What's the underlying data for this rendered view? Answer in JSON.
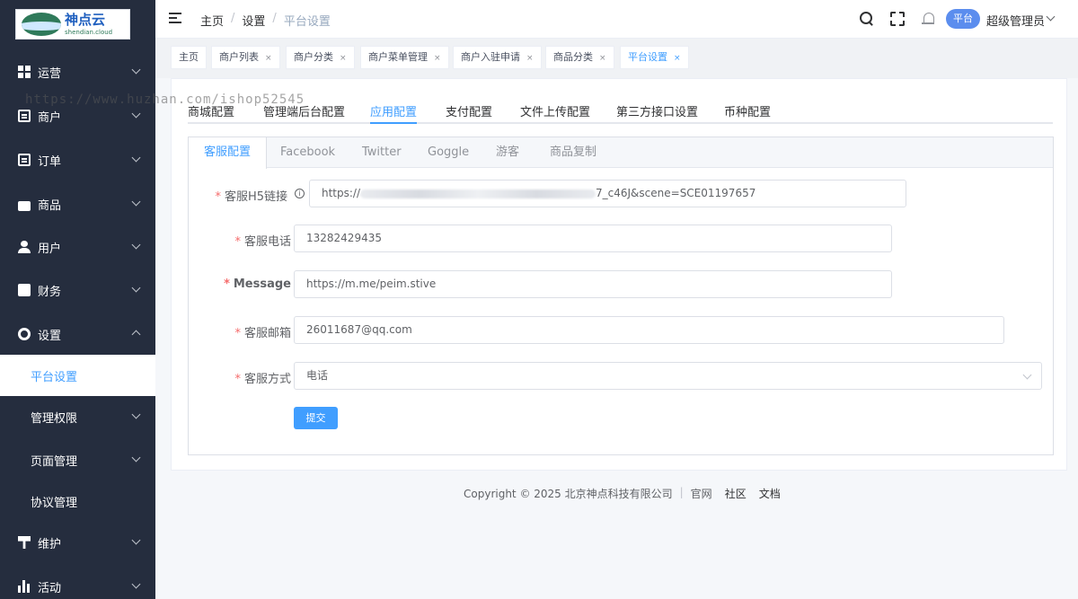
{
  "logo": {
    "name_cn": "神点云",
    "name_en": "shendian.cloud"
  },
  "watermark": "https://www.huzhan.com/ishop52545",
  "sidebar": {
    "items": [
      {
        "label": "运营",
        "icon": "grid-icon"
      },
      {
        "label": "商户",
        "icon": "shop-icon"
      },
      {
        "label": "订单",
        "icon": "order-icon"
      },
      {
        "label": "商品",
        "icon": "bag-icon"
      },
      {
        "label": "用户",
        "icon": "user-icon"
      },
      {
        "label": "财务",
        "icon": "wallet-icon"
      },
      {
        "label": "设置",
        "icon": "gear-icon"
      },
      {
        "label": "平台设置"
      },
      {
        "label": "管理权限"
      },
      {
        "label": "页面管理"
      },
      {
        "label": "协议管理"
      },
      {
        "label": "维护",
        "icon": "tool-icon"
      },
      {
        "label": "活动",
        "icon": "bars-icon"
      }
    ]
  },
  "header": {
    "breadcrumb": [
      "主页",
      "设置",
      "平台设置"
    ],
    "separator": "/",
    "role_badge": "平台",
    "user_name": "超级管理员"
  },
  "tags": [
    "主页",
    "商户列表",
    "商户分类",
    "商户菜单管理",
    "商户入驻申请",
    "商品分类",
    "平台设置"
  ],
  "tag_close": "×",
  "top_tabs": [
    "商城配置",
    "管理端后台配置",
    "应用配置",
    "支付配置",
    "文件上传配置",
    "第三方接口设置",
    "币种配置"
  ],
  "inner_tabs": [
    "客服配置",
    "Facebook",
    "Twitter",
    "Goggle",
    "游客",
    "商品复制"
  ],
  "form": {
    "required_mark": "*",
    "h5_link": {
      "label": "客服H5链接",
      "value_prefix": "https://",
      "value_suffix": "7_c46J&scene=SCE01197657"
    },
    "phone": {
      "label": "客服电话",
      "value": "13282429435"
    },
    "message": {
      "label": "Message",
      "value": "https://m.me/peim.stive"
    },
    "email": {
      "label": "客服邮箱",
      "value": "26011687@qq.com"
    },
    "method": {
      "label": "客服方式",
      "value": "电话"
    },
    "submit_label": "提交"
  },
  "footer": {
    "copyright": "Copyright © 2025 北京神点科技有限公司",
    "divider": "|",
    "links": [
      "官网",
      "社区",
      "文档"
    ]
  },
  "colors": {
    "primary": "#409eff",
    "sidebar_bg": "#252d3e",
    "required": "#f56c6c",
    "badge": "#5b8dee"
  }
}
